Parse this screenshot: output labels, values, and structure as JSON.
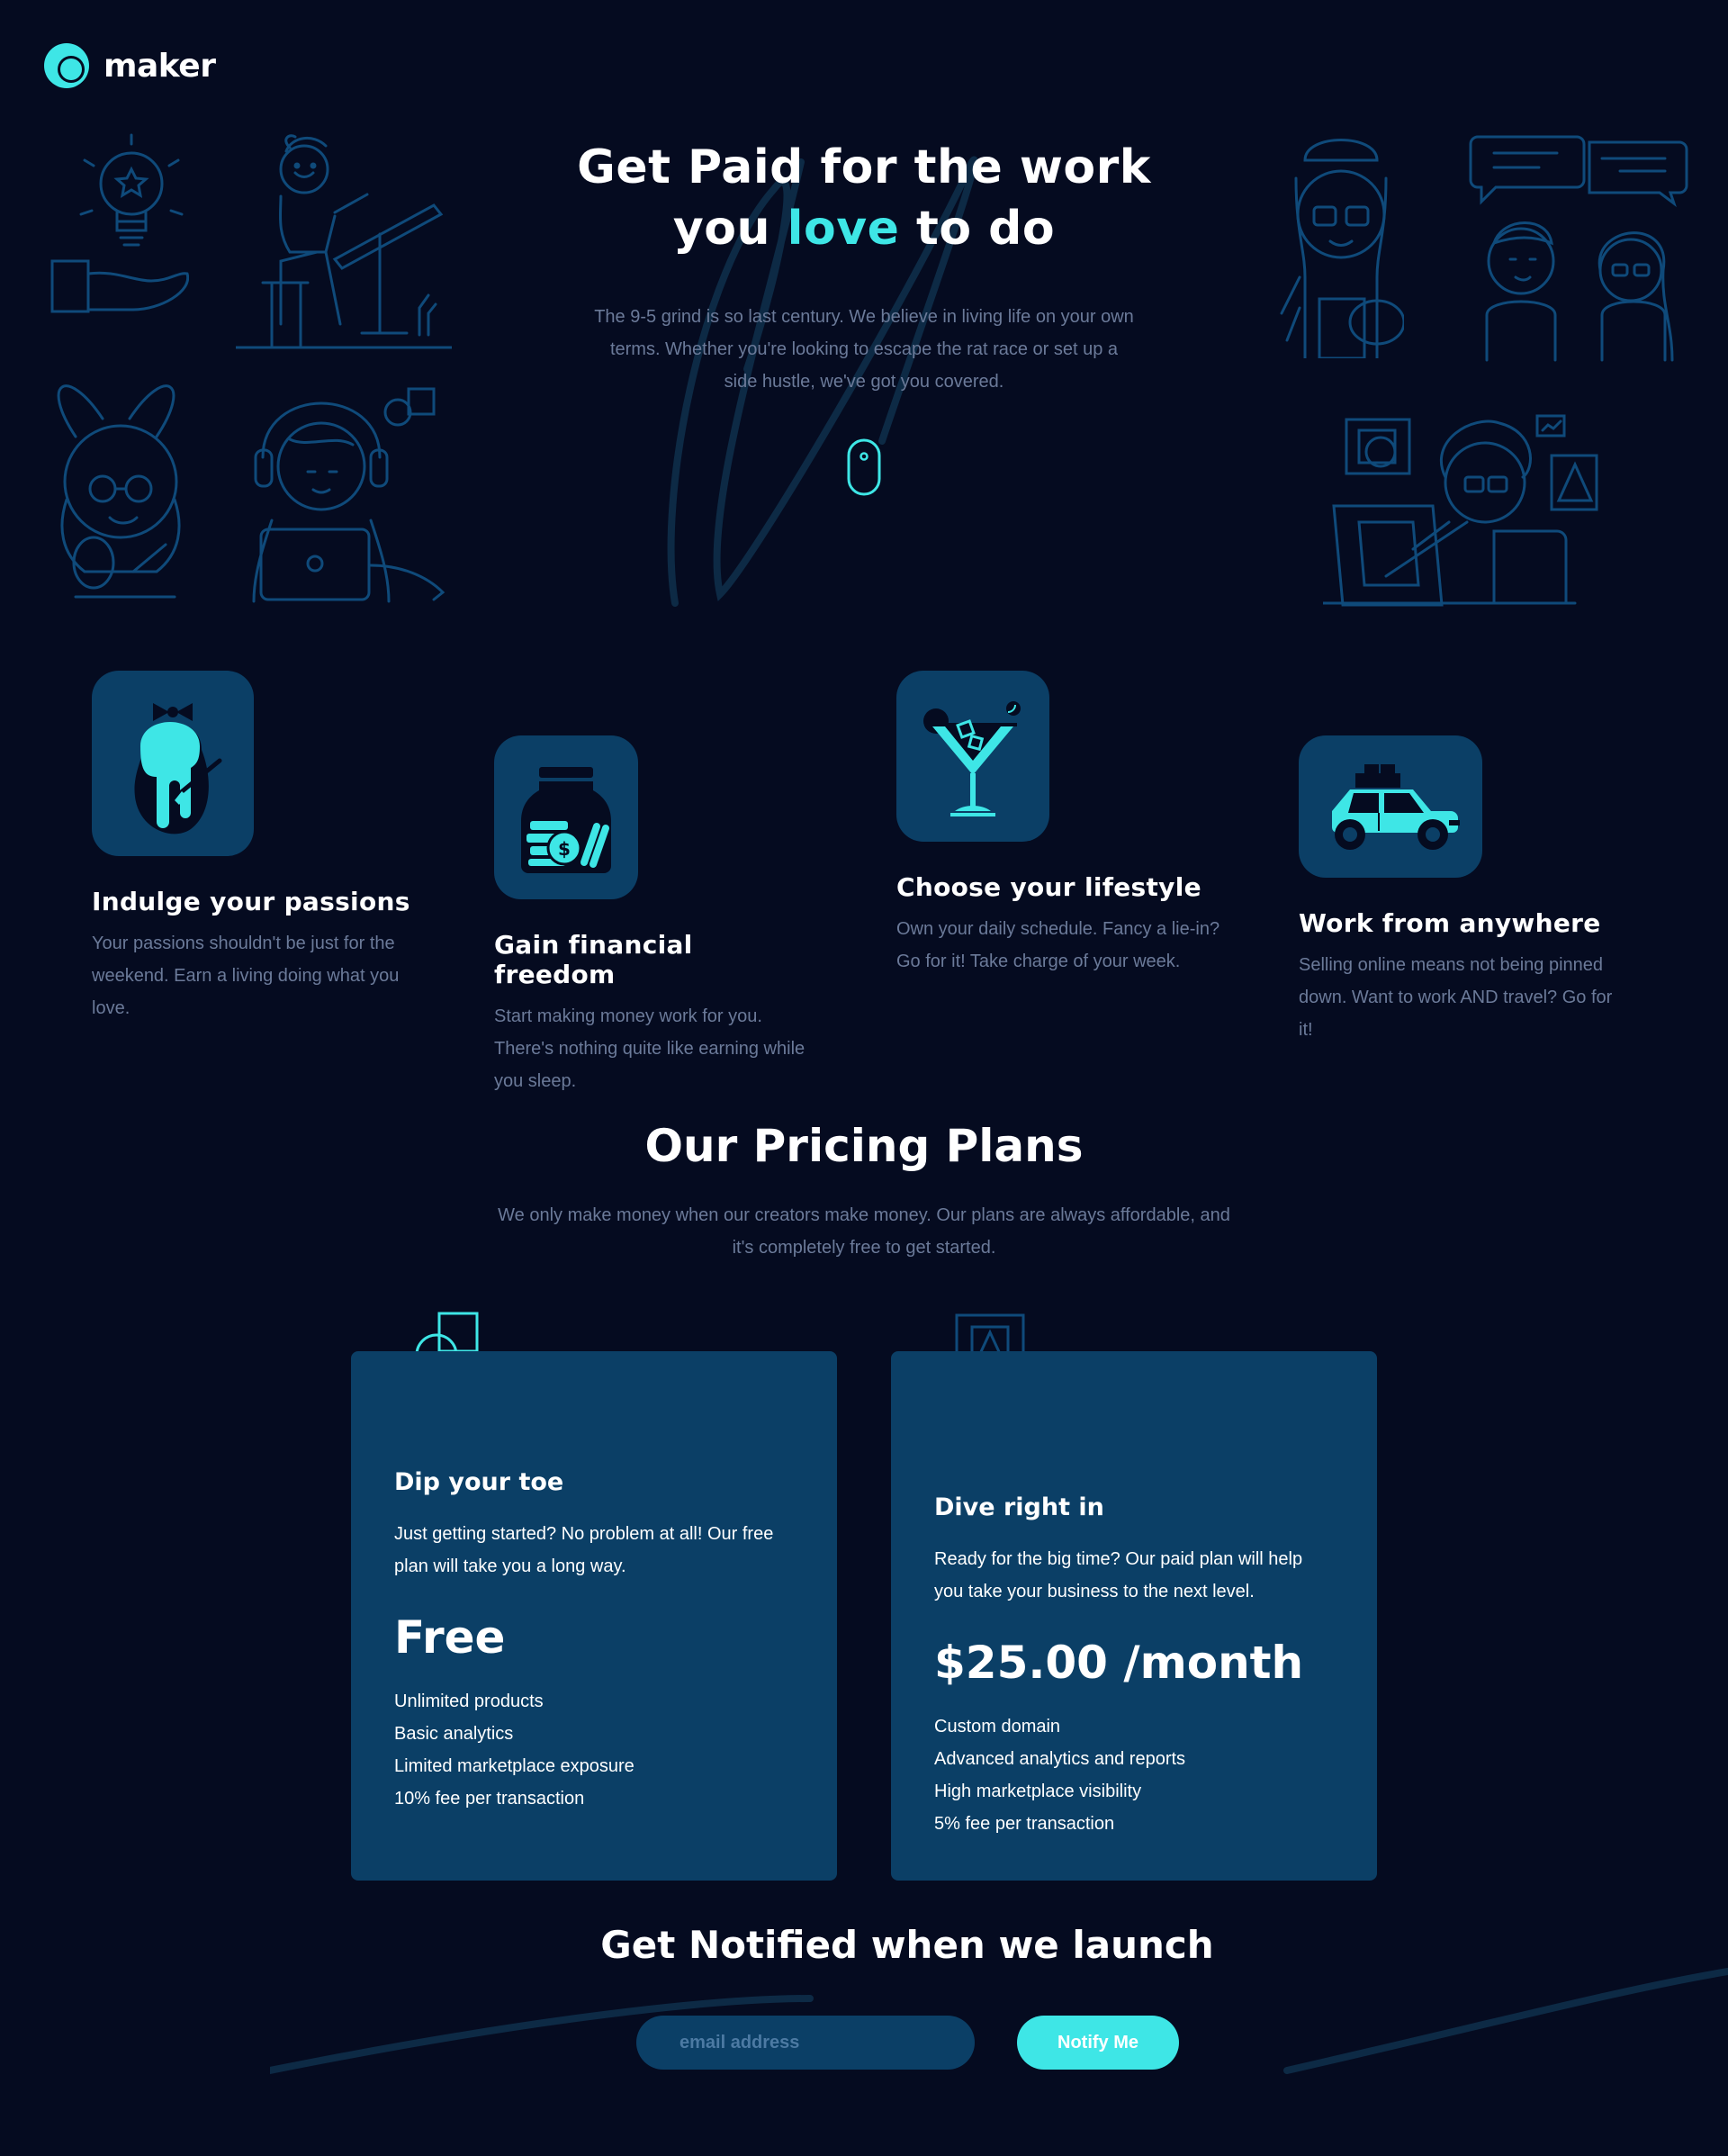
{
  "brand": {
    "name": "maker",
    "accent": "#3ee6e6",
    "tile": "#0b3f66",
    "background": "#050b20"
  },
  "hero": {
    "title_part1": "Get Paid for the work",
    "title_part2_pre": "you ",
    "title_accent": "love",
    "title_part2_post": " to do",
    "subtitle": "The 9-5 grind is so last century. We believe in living life on your own terms. Whether you're looking to escape the rat race or set up a side hustle, we've got you covered.",
    "scroll_icon": "mouse-scroll-icon"
  },
  "features": [
    {
      "icon": "paint-drip-icon",
      "title": "Indulge your passions",
      "text": "Your passions shouldn't be just for the weekend. Earn a living doing what you love."
    },
    {
      "icon": "money-jar-icon",
      "title": "Gain financial freedom",
      "text": "Start making money work for you. There's nothing quite like earning while you sleep."
    },
    {
      "icon": "cocktail-icon",
      "title": "Choose your lifestyle",
      "text": "Own your daily schedule. Fancy a lie-in? Go for it! Take charge of your week."
    },
    {
      "icon": "car-icon",
      "title": "Work from anywhere",
      "text": "Selling online means not being pinned down. Want to work AND travel? Go for it!"
    }
  ],
  "pricing": {
    "title": "Our Pricing Plans",
    "subtitle": "We only make money when our creators make money. Our plans are always affordable, and it's completely free to get started.",
    "plans": [
      {
        "name": "Dip your toe",
        "description": "Just getting started? No problem at all! Our free plan will take you a long way.",
        "price": "Free",
        "features": [
          "Unlimited products",
          "Basic analytics",
          "Limited marketplace exposure",
          "10% fee per transaction"
        ]
      },
      {
        "name": "Dive right in",
        "description": "Ready for the big time? Our paid plan will help you take your business to the next level.",
        "price": "$25.00 /month",
        "features": [
          "Custom domain",
          "Advanced analytics and reports",
          "High marketplace visibility",
          "5% fee per transaction"
        ]
      }
    ]
  },
  "notify": {
    "title": "Get Notified when we launch",
    "email_placeholder": "email address",
    "button_label": "Notify Me"
  }
}
